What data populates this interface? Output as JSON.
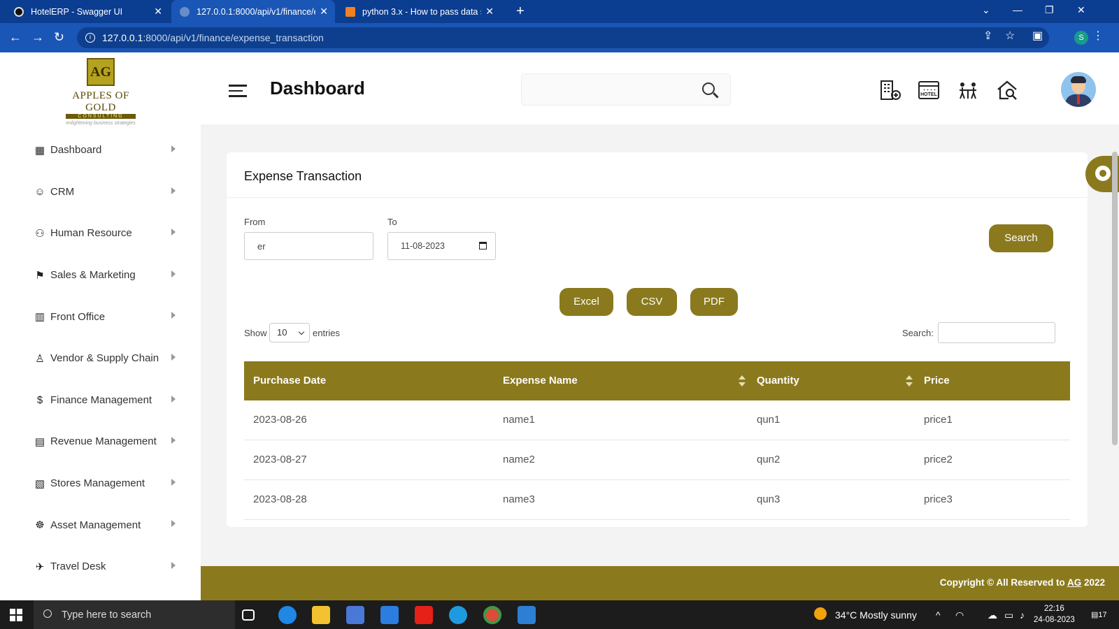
{
  "browser": {
    "tabs": [
      {
        "title": "HotelERP - Swagger UI",
        "active": false
      },
      {
        "title": "127.0.0.1:8000/api/v1/finance/ex",
        "active": true
      },
      {
        "title": "python 3.x - How to pass data sa",
        "active": false
      }
    ],
    "new_tab": "+",
    "address": {
      "host": "127.0.0.1",
      "path": ":8000/api/v1/finance/expense_transaction"
    },
    "profile_initial": "S"
  },
  "sidebar": {
    "logo": {
      "mark": "AG",
      "brand": "APPLES OF GOLD",
      "sub": "CONSULTING",
      "tagline": "enlightening business strategies"
    },
    "items": [
      {
        "label": "Dashboard",
        "icon": "grid-icon"
      },
      {
        "label": "CRM",
        "icon": "crm-icon"
      },
      {
        "label": "Human Resource",
        "icon": "people-icon"
      },
      {
        "label": "Sales & Marketing",
        "icon": "sales-icon"
      },
      {
        "label": "Front Office",
        "icon": "building-icon"
      },
      {
        "label": "Vendor & Supply Chain",
        "icon": "vendor-icon"
      },
      {
        "label": "Finance Management",
        "icon": "finance-icon"
      },
      {
        "label": "Revenue Management",
        "icon": "revenue-icon"
      },
      {
        "label": "Stores Management",
        "icon": "stores-icon"
      },
      {
        "label": "Asset Management",
        "icon": "asset-icon"
      },
      {
        "label": "Travel Desk",
        "icon": "travel-icon"
      }
    ]
  },
  "header": {
    "title": "Dashboard"
  },
  "card": {
    "title": "Expense Transaction",
    "from_label": "From",
    "from_value": "er",
    "to_label": "To",
    "to_value": "11-08-2023",
    "search_button": "Search",
    "export_buttons": [
      "Excel",
      "CSV",
      "PDF"
    ],
    "show_label": "Show",
    "entries_value": "10",
    "entries_label": "entries",
    "table_search_label": "Search:"
  },
  "table": {
    "columns": [
      "Purchase Date",
      "Expense Name",
      "Quantity",
      "Price"
    ],
    "rows": [
      [
        "2023-08-26",
        "name1",
        "qun1",
        "price1"
      ],
      [
        "2023-08-27",
        "name2",
        "qun2",
        "price2"
      ],
      [
        "2023-08-28",
        "name3",
        "qun3",
        "price3"
      ]
    ]
  },
  "footer": {
    "prefix": "Copyright © All Reserved to ",
    "link": "AG",
    "year": " 2022"
  },
  "taskbar": {
    "search_placeholder": "Type here to search",
    "weather": "34°C  Mostly sunny",
    "time": "22:16",
    "date": "24-08-2023",
    "notifications": "17"
  },
  "colors": {
    "accent": "#8a7a1d",
    "browser": "#1a56b5"
  }
}
